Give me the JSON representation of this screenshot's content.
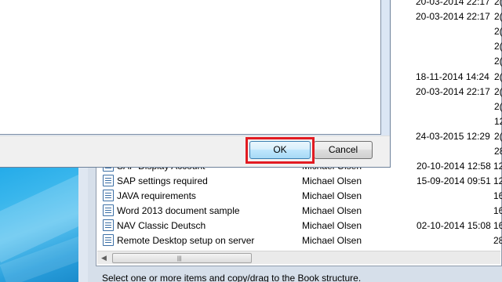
{
  "dialog": {
    "ok_label": "OK",
    "cancel_label": "Cancel"
  },
  "right_dates": {
    "d1": "20-03-2014 22:17",
    "d2": "20-03-2014 22:17",
    "d3": "18-11-2014 14:24",
    "d4": "20-03-2014 22:17",
    "d5": "24-03-2015 12:29"
  },
  "right_edge_fragments": [
    "2(",
    "2(",
    "2(",
    "2(",
    "2(",
    "2(",
    "2(",
    "2(",
    "12",
    "2(",
    "2(",
    "28"
  ],
  "list": {
    "rows": [
      {
        "title": "SAP Display Account",
        "author": "Michael Olsen",
        "date": "20-10-2014 12:58",
        "extra": "12"
      },
      {
        "title": "SAP settings required",
        "author": "Michael Olsen",
        "date": "15-09-2014 09:51",
        "extra": "12"
      },
      {
        "title": "JAVA requirements",
        "author": "Michael Olsen",
        "date": "",
        "extra": "16"
      },
      {
        "title": "Word 2013 document sample",
        "author": "Michael Olsen",
        "date": "",
        "extra": "16"
      },
      {
        "title": "NAV Classic Deutsch",
        "author": "Michael Olsen",
        "date": "02-10-2014 15:08",
        "extra": "16"
      },
      {
        "title": "Remote Desktop setup on server",
        "author": "Michael Olsen",
        "date": "",
        "extra": "28"
      }
    ]
  },
  "status_bar": {
    "text": "Select one or more items and copy/drag to the Book structure."
  },
  "colors": {
    "highlight": "#e21b22",
    "desktop": "#39b6ec"
  }
}
